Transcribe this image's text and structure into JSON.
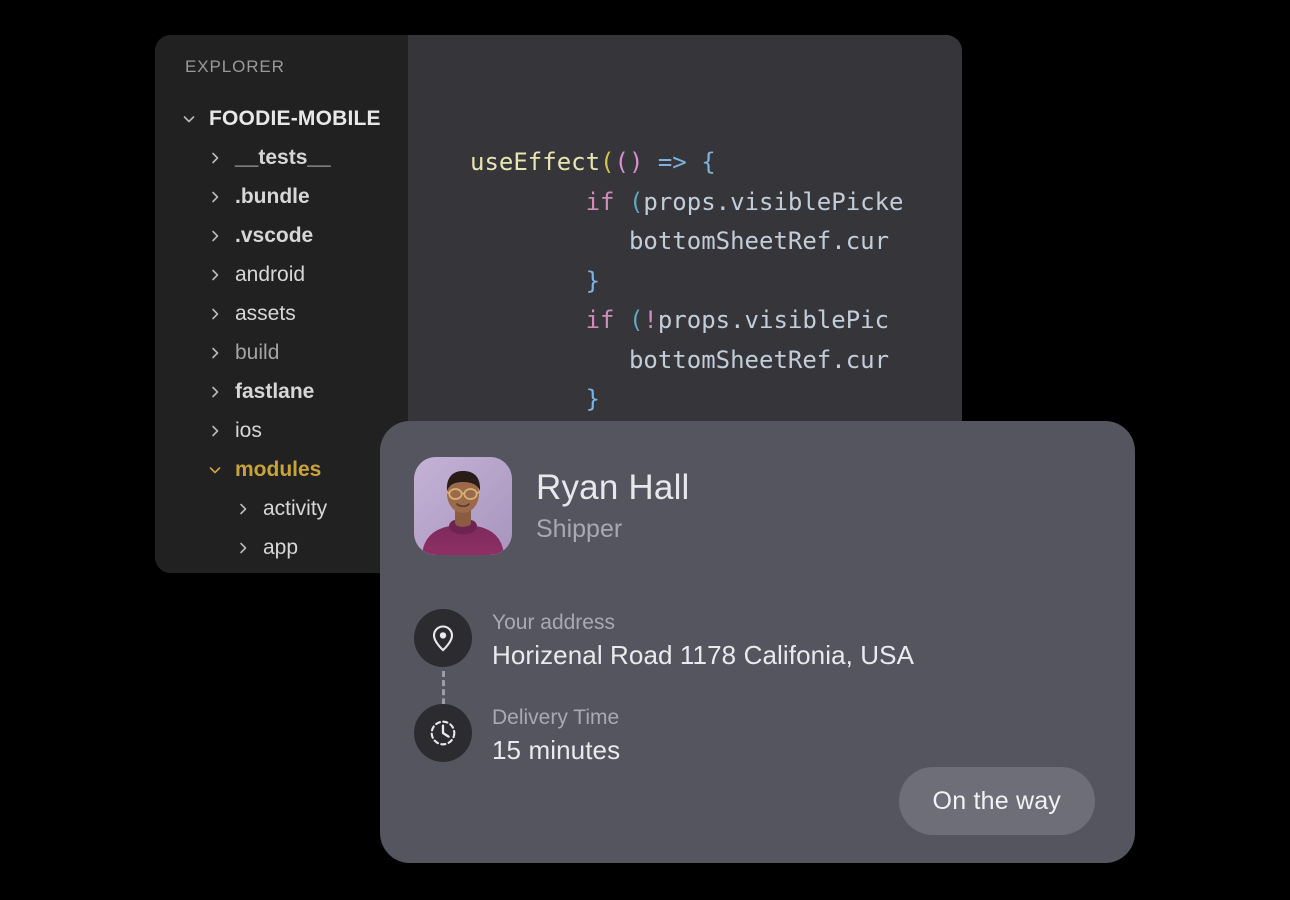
{
  "ide": {
    "explorer_title": "EXPLORER",
    "tree": [
      {
        "label": "FOODIE-MOBILE",
        "depth": 0,
        "expanded": true,
        "style": "bold"
      },
      {
        "label": "__tests__",
        "depth": 1,
        "expanded": false,
        "style": "bold"
      },
      {
        "label": ".bundle",
        "depth": 1,
        "expanded": false,
        "style": "bold"
      },
      {
        "label": ".vscode",
        "depth": 1,
        "expanded": false,
        "style": "bold"
      },
      {
        "label": "android",
        "depth": 1,
        "expanded": false,
        "style": "normal"
      },
      {
        "label": "assets",
        "depth": 1,
        "expanded": false,
        "style": "normal"
      },
      {
        "label": "build",
        "depth": 1,
        "expanded": false,
        "style": "dim"
      },
      {
        "label": "fastlane",
        "depth": 1,
        "expanded": false,
        "style": "bold"
      },
      {
        "label": "ios",
        "depth": 1,
        "expanded": false,
        "style": "normal"
      },
      {
        "label": "modules",
        "depth": 1,
        "expanded": true,
        "style": "gold"
      },
      {
        "label": "activity",
        "depth": 2,
        "expanded": false,
        "style": "normal"
      },
      {
        "label": "app",
        "depth": 2,
        "expanded": false,
        "style": "normal"
      }
    ],
    "code_lines": [
      {
        "indent": 0,
        "tokens": [
          {
            "t": "useEffect",
            "c": "fn"
          },
          {
            "t": "(",
            "c": "paren1"
          },
          {
            "t": "()",
            "c": "paren2"
          },
          {
            "t": " => ",
            "c": "arrow"
          },
          {
            "t": "{",
            "c": "brace"
          }
        ]
      },
      {
        "indent": 8,
        "tokens": [
          {
            "t": "if ",
            "c": "kw"
          },
          {
            "t": "(",
            "c": "paren3"
          },
          {
            "t": "props.visiblePicke",
            "c": "id"
          }
        ]
      },
      {
        "indent": 11,
        "tokens": [
          {
            "t": "bottomSheetRef.cur",
            "c": "id"
          }
        ]
      },
      {
        "indent": 8,
        "tokens": [
          {
            "t": "}",
            "c": "brace"
          }
        ]
      },
      {
        "indent": 8,
        "tokens": [
          {
            "t": "if ",
            "c": "kw"
          },
          {
            "t": "(",
            "c": "paren3"
          },
          {
            "t": "!",
            "c": "bang"
          },
          {
            "t": "props.visiblePic",
            "c": "id"
          }
        ]
      },
      {
        "indent": 11,
        "tokens": [
          {
            "t": "bottomSheetRef.cur",
            "c": "id"
          }
        ]
      },
      {
        "indent": 8,
        "tokens": [
          {
            "t": "}",
            "c": "brace"
          }
        ]
      }
    ]
  },
  "delivery_card": {
    "shipper_name": "Ryan Hall",
    "shipper_role": "Shipper",
    "avatar_icon": "shipper-avatar-photo",
    "address": {
      "icon": "location-pin-icon",
      "label": "Your address",
      "value": "Horizenal Road 1178 Califonia, USA"
    },
    "delivery_time": {
      "icon": "clock-icon",
      "label": "Delivery Time",
      "value": "15 minutes"
    },
    "status_button_label": "On the way"
  },
  "colors": {
    "page_background": "#000000",
    "sidebar_background": "#212121",
    "editor_background": "#35353a",
    "card_background": "#55555f",
    "status_button": "#6e6e79",
    "folder_highlight": "#c9a33a",
    "icon_circle": "#2b2b30"
  }
}
